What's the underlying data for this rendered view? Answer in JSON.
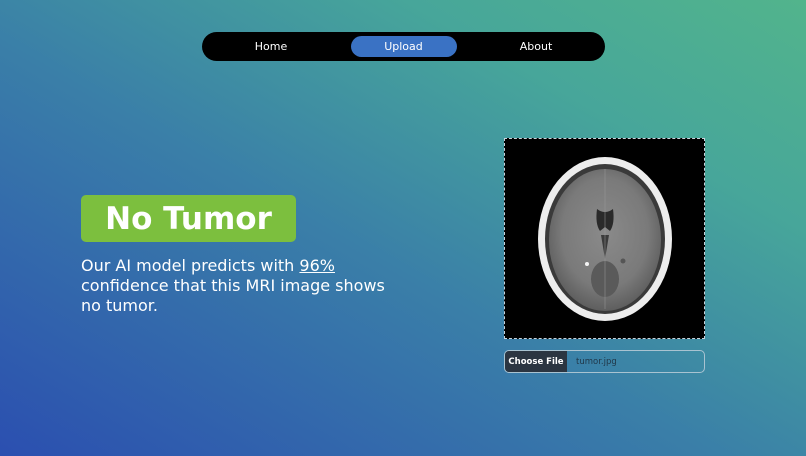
{
  "nav": {
    "items": [
      {
        "label": "Home",
        "active": false
      },
      {
        "label": "Upload",
        "active": true
      },
      {
        "label": "About",
        "active": false
      }
    ]
  },
  "result": {
    "label": "No Tumor",
    "description_prefix": "Our AI model predicts with ",
    "confidence": "96%",
    "description_suffix": " confidence that this MRI image shows no tumor."
  },
  "upload": {
    "button_label": "Choose File",
    "file_name": "tumor.jpg"
  },
  "colors": {
    "nav_active": "#3a72c4",
    "badge": "#7cbf3e"
  }
}
